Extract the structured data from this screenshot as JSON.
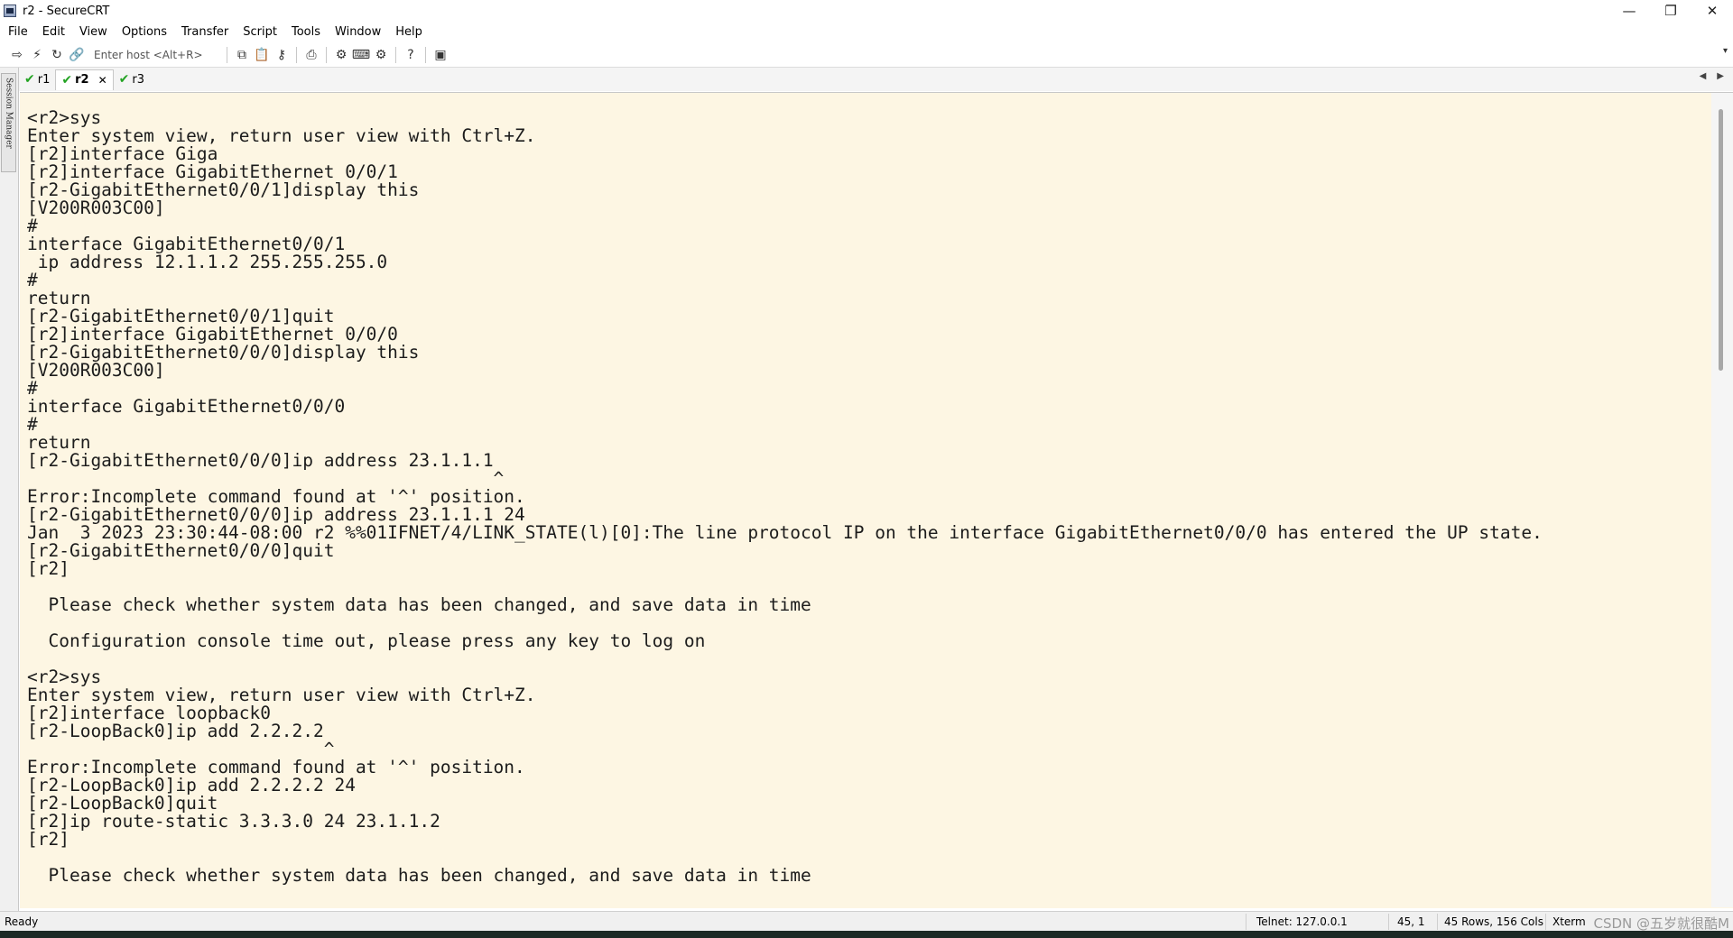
{
  "window": {
    "title": "r2 - SecureCRT"
  },
  "menu": [
    "File",
    "Edit",
    "View",
    "Options",
    "Transfer",
    "Script",
    "Tools",
    "Window",
    "Help"
  ],
  "toolbar": {
    "host_placeholder": "Enter host <Alt+R>"
  },
  "sidebar": {
    "label": "Session Manager"
  },
  "tabs": [
    {
      "label": "r1",
      "status": "connected",
      "active": false
    },
    {
      "label": "r2",
      "status": "connected",
      "active": true
    },
    {
      "label": "r3",
      "status": "connected",
      "active": false
    }
  ],
  "terminal": {
    "text": "<r2>sys\nEnter system view, return user view with Ctrl+Z.\n[r2]interface Giga\n[r2]interface GigabitEthernet 0/0/1\n[r2-GigabitEthernet0/0/1]display this\n[V200R003C00]\n#\ninterface GigabitEthernet0/0/1\n ip address 12.1.1.2 255.255.255.0\n#\nreturn\n[r2-GigabitEthernet0/0/1]quit\n[r2]interface GigabitEthernet 0/0/0\n[r2-GigabitEthernet0/0/0]display this\n[V200R003C00]\n#\ninterface GigabitEthernet0/0/0\n#\nreturn\n[r2-GigabitEthernet0/0/0]ip address 23.1.1.1\n                                            ^\nError:Incomplete command found at '^' position.\n[r2-GigabitEthernet0/0/0]ip address 23.1.1.1 24\nJan  3 2023 23:30:44-08:00 r2 %%01IFNET/4/LINK_STATE(l)[0]:The line protocol IP on the interface GigabitEthernet0/0/0 has entered the UP state.\n[r2-GigabitEthernet0/0/0]quit\n[r2]\n\n  Please check whether system data has been changed, and save data in time\n\n  Configuration console time out, please press any key to log on\n\n<r2>sys\nEnter system view, return user view with Ctrl+Z.\n[r2]interface loopback0\n[r2-LoopBack0]ip add 2.2.2.2\n                            ^\nError:Incomplete command found at '^' position.\n[r2-LoopBack0]ip add 2.2.2.2 24\n[r2-LoopBack0]quit\n[r2]ip route-static 3.3.3.0 24 23.1.1.2\n[r2]\n\n  Please check whether system data has been changed, and save data in time"
  },
  "status": {
    "ready": "Ready",
    "connection": "Telnet: 127.0.0.1",
    "cursor": "45,   1",
    "size": "45 Rows, 156 Cols",
    "emulation": "Xterm",
    "overlay": "CSDN @五岁就很酷M"
  }
}
